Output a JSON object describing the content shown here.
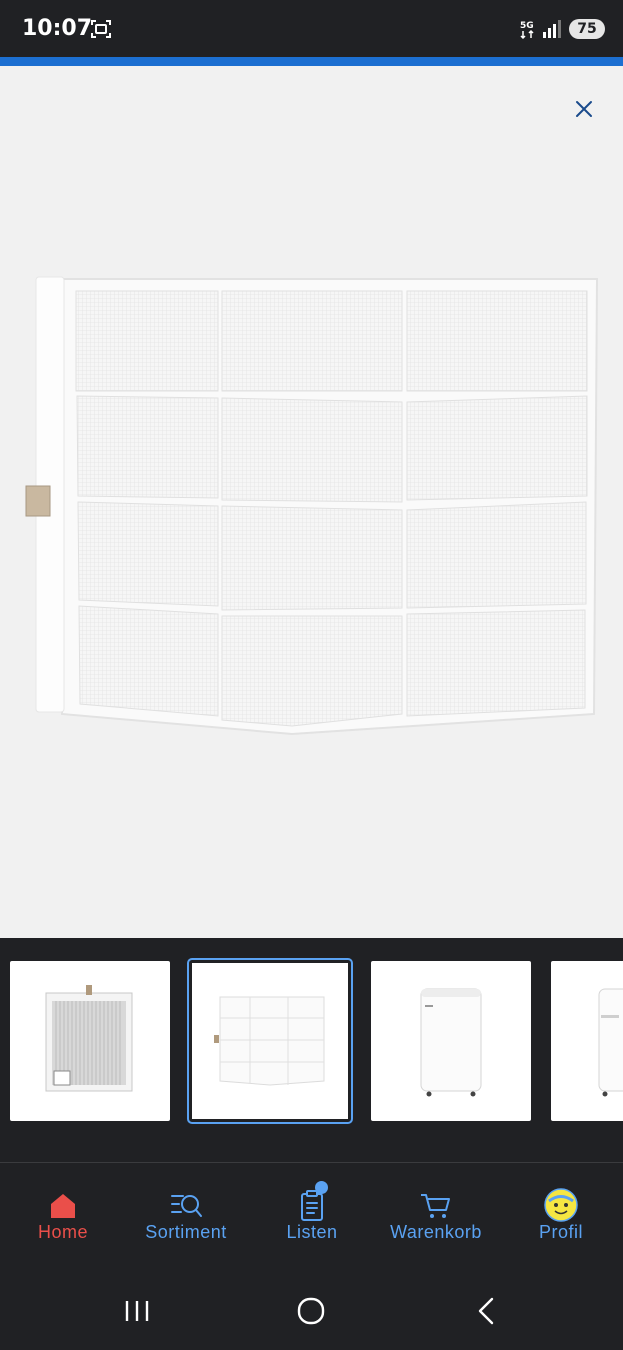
{
  "status_bar": {
    "time": "10:07",
    "network_label": "5G",
    "battery": "75"
  },
  "viewer": {
    "image_name": "air-filter-panel"
  },
  "thumbnails": [
    {
      "name": "filter-back-view",
      "selected": false
    },
    {
      "name": "filter-panel",
      "selected": true
    },
    {
      "name": "air-conditioner-front",
      "selected": false
    },
    {
      "name": "air-conditioner-side",
      "selected": false
    }
  ],
  "bottom_nav": {
    "items": [
      {
        "label": "Home",
        "icon": "home-icon",
        "active": true
      },
      {
        "label": "Sortiment",
        "icon": "search-list-icon",
        "active": false
      },
      {
        "label": "Listen",
        "icon": "list-icon",
        "active": false,
        "badge": true
      },
      {
        "label": "Warenkorb",
        "icon": "cart-icon",
        "active": false
      },
      {
        "label": "Profil",
        "icon": "profile-avatar-icon",
        "active": false
      }
    ]
  },
  "colors": {
    "accent_blue": "#1c6fd1",
    "nav_blue": "#5aa2f2",
    "active_red": "#ea4f4a",
    "dark_bg": "#202124",
    "viewer_bg": "#f1f1f1"
  }
}
